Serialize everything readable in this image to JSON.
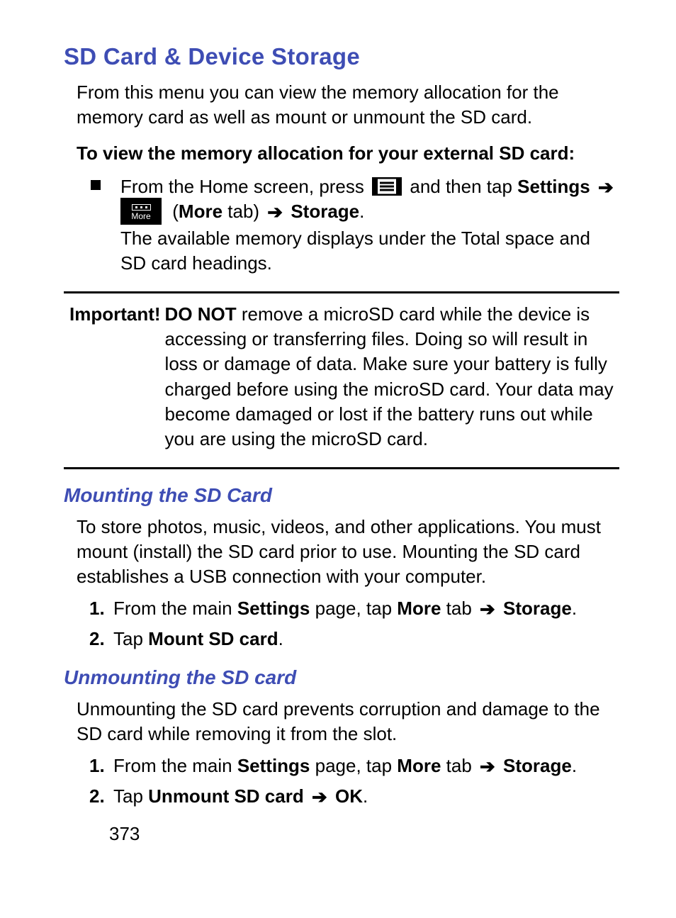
{
  "heading": "SD Card & Device Storage",
  "intro": "From this menu you can view the memory allocation for the memory card as well as mount or unmount the SD card.",
  "subhead": "To view the memory allocation for your external SD card:",
  "step": {
    "pre": "From the Home screen, press ",
    "afterMenu": " and then tap ",
    "settings": "Settings",
    "moreTabOpen": " (",
    "moreWord": "More",
    "moreTabClose": " tab) ",
    "storage": "Storage",
    "period": ".",
    "post": "The available memory displays under the Total space and SD card headings."
  },
  "moreIconLabel": "More",
  "important": {
    "label": "Important!",
    "donot": "DO NOT",
    "body": " remove a microSD card while the device is accessing or transferring files. Doing so will result in loss or damage of data. Make sure your battery is fully charged before using the microSD card. Your data may become damaged or lost if the battery runs out while you are using the microSD card."
  },
  "mount": {
    "title": "Mounting the SD Card",
    "para": "To store photos, music, videos, and other applications. You must mount (install) the SD card prior to use. Mounting the SD card establishes a USB connection with your computer.",
    "step1": {
      "num": "1.",
      "a": "From the main ",
      "settings": "Settings",
      "b": " page, tap ",
      "more": "More",
      "c": " tab ",
      "storage": "Storage",
      "d": "."
    },
    "step2": {
      "num": "2.",
      "a": "Tap ",
      "cmd": "Mount SD card",
      "b": "."
    }
  },
  "unmount": {
    "title": "Unmounting the SD card",
    "para": "Unmounting the SD card prevents corruption and damage to the SD card while removing it from the slot.",
    "step1": {
      "num": "1.",
      "a": "From the main ",
      "settings": "Settings",
      "b": " page, tap ",
      "more": "More",
      "c": " tab  ",
      "storage": "Storage",
      "d": "."
    },
    "step2": {
      "num": "2.",
      "a": "Tap ",
      "cmd": "Unmount SD card",
      "b": " ",
      "ok": "OK",
      "c": "."
    }
  },
  "pageNumber": "373"
}
